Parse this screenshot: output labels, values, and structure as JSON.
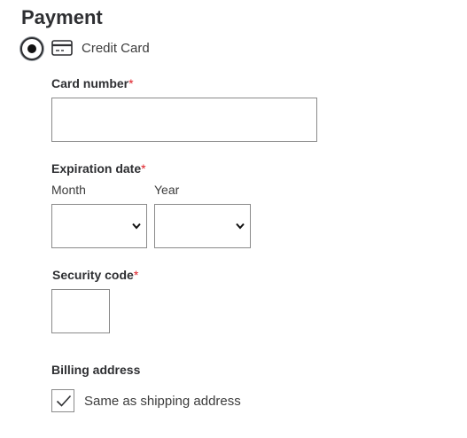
{
  "payment": {
    "title": "Payment",
    "method": {
      "label": "Credit Card",
      "selected": true,
      "icon": "credit-card-icon"
    }
  },
  "form": {
    "card_number": {
      "label": "Card number",
      "required_marker": "*",
      "value": ""
    },
    "expiration": {
      "label": "Expiration date",
      "required_marker": "*",
      "month": {
        "label": "Month",
        "value": ""
      },
      "year": {
        "label": "Year",
        "value": ""
      }
    },
    "security_code": {
      "label": "Security code",
      "required_marker": "*",
      "value": ""
    },
    "billing": {
      "label": "Billing address",
      "same_as_shipping": {
        "label": "Same as shipping address",
        "checked": true
      }
    }
  }
}
